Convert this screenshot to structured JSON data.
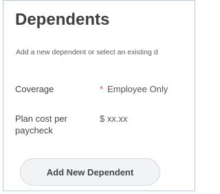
{
  "panel": {
    "title": "Dependents",
    "instruction": "Add a new dependent or select an existing d"
  },
  "fields": {
    "coverage": {
      "label": "Coverage",
      "required_marker": "*",
      "value": "Employee Only"
    },
    "plan_cost": {
      "label": "Plan cost per paycheck",
      "value": "$ xx.xx"
    }
  },
  "actions": {
    "add_new_dependent": "Add New Dependent"
  },
  "colors": {
    "required": "#e14b4b",
    "border": "#b9c7d8",
    "button_bg": "#f1f3f5"
  }
}
